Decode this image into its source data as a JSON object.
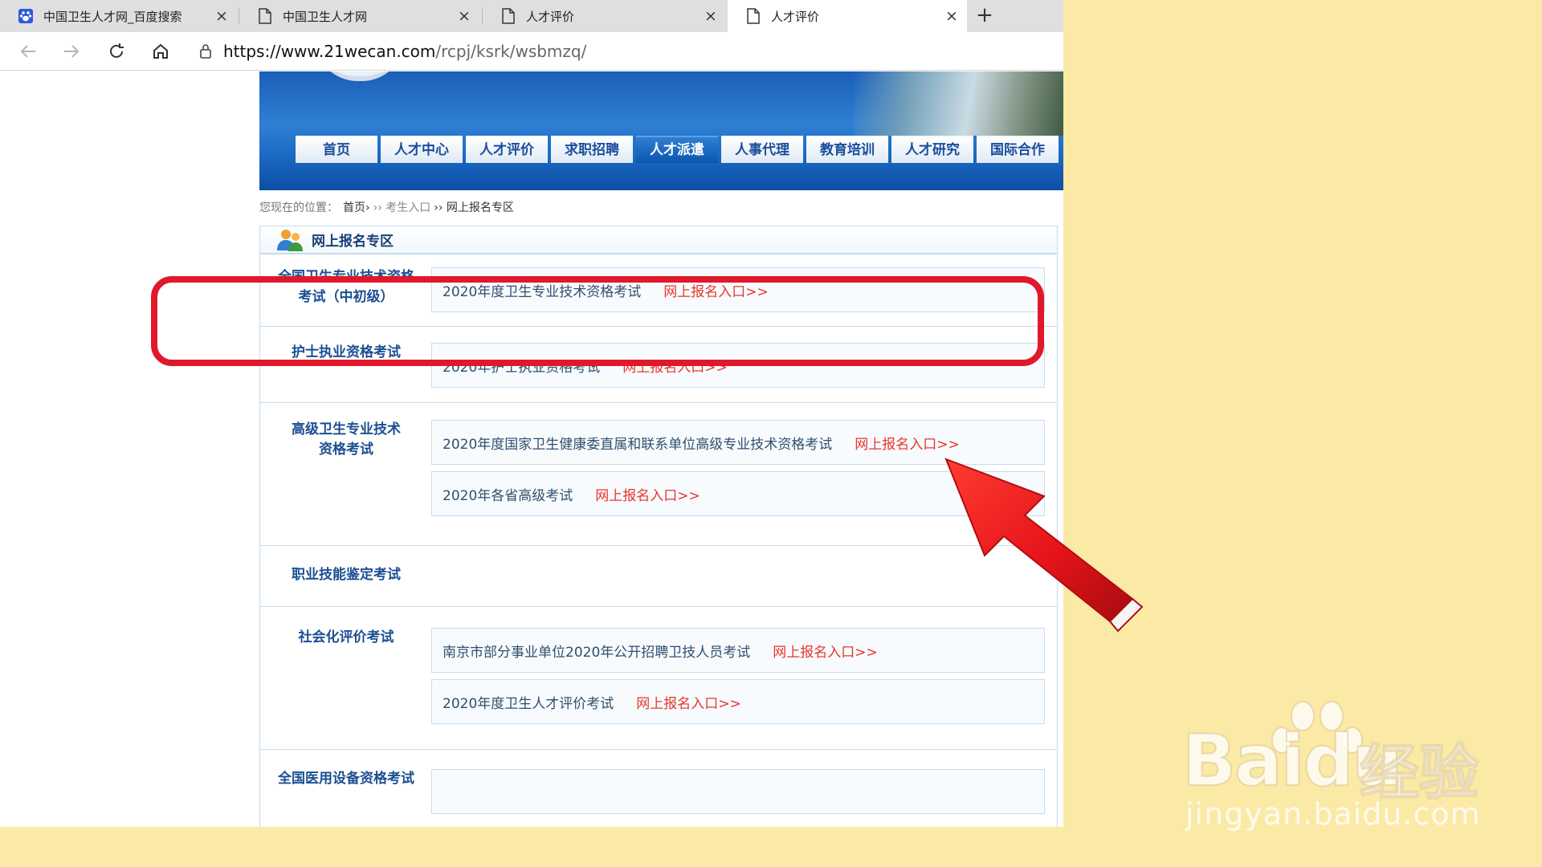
{
  "browser": {
    "tabs": [
      {
        "title": "中国卫生人才网_百度搜索",
        "icon": "baidu-paw-icon",
        "close": "×"
      },
      {
        "title": "中国卫生人才网",
        "icon": "page-icon",
        "close": "×"
      },
      {
        "title": "人才评价",
        "icon": "page-icon",
        "close": "×"
      },
      {
        "title": "人才评价",
        "icon": "page-icon",
        "close": "×"
      }
    ],
    "new_tab": "+",
    "url_host": "https://www.21wecan.com",
    "url_path": "/rcpj/ksrk/wsbmzq/"
  },
  "site": {
    "nav": [
      "首页",
      "人才中心",
      "人才评价",
      "求职招聘",
      "人才派遣",
      "人事代理",
      "教育培训",
      "人才研究",
      "国际合作"
    ],
    "nav_active_index": 4,
    "breadcrumb": {
      "prefix": "您现在的位置：",
      "items": [
        "首页›",
        "›› 考生入口",
        "›› 网上报名专区"
      ]
    },
    "zone_title": "网上报名专区",
    "sections": [
      {
        "category": [
          "全国卫生专业技术资格",
          "考试（中初级）"
        ],
        "entries": [
          {
            "name": "2020年度卫生专业技术资格考试",
            "link": "网上报名入口>>"
          }
        ]
      },
      {
        "category": [
          "护士执业资格考试"
        ],
        "entries": [
          {
            "name": "2020年护士执业资格考试",
            "link": "网上报名入口>>"
          }
        ]
      },
      {
        "category": [
          "高级卫生专业技术",
          "资格考试"
        ],
        "entries": [
          {
            "name": "2020年度国家卫生健康委直属和联系单位高级专业技术资格考试",
            "link": "网上报名入口>>"
          },
          {
            "name": "2020年各省高级考试",
            "link": "网上报名入口>>"
          }
        ]
      },
      {
        "category": [
          "职业技能鉴定考试"
        ],
        "entries": []
      },
      {
        "category": [
          "社会化评价考试"
        ],
        "entries": [
          {
            "name": "南京市部分事业单位2020年公开招聘卫技人员考试",
            "link": "网上报名入口>>"
          },
          {
            "name": "2020年度卫生人才评价考试",
            "link": "网上报名入口>>"
          }
        ]
      },
      {
        "category": [
          "全国医用设备资格考试"
        ],
        "entries": []
      }
    ]
  },
  "watermark": {
    "brand": "Bai",
    "brand2": "du",
    "jingyan": "经验",
    "url": "jingyan.baidu.com"
  },
  "taskbar": {
    "items": [
      "windows-start-icon",
      "search-icon",
      "edge-icon",
      "lark-icon",
      "mail-icon",
      "ie-icon",
      "app-icon",
      "file-explorer-icon",
      "color-app-icon",
      "recorder-icon",
      "excel-icon",
      "word-icon"
    ]
  },
  "colors": {
    "highlight": "#e0182c",
    "arrow": "#e41b1b",
    "link": "#e8342c",
    "category": "#1c4f92",
    "background": "#fbe9a6"
  }
}
